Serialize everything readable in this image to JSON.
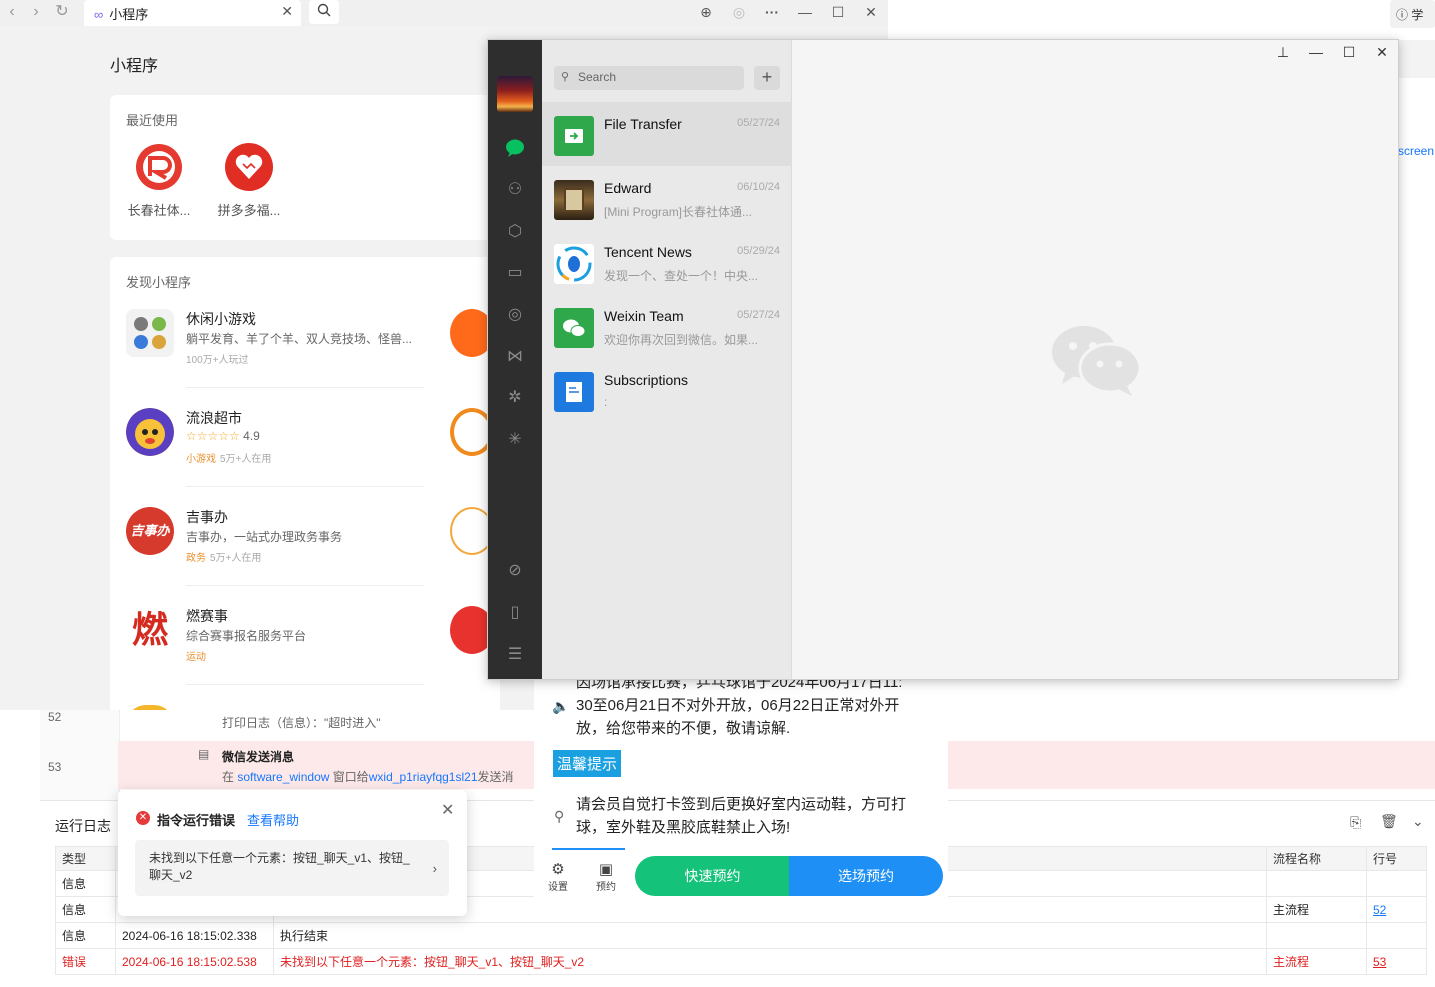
{
  "browser": {
    "tab_title": "小程序",
    "help_label": "学"
  },
  "screen_link": "screen",
  "miniprogram": {
    "page_title": "小程序",
    "recent": {
      "title": "最近使用",
      "apps": [
        {
          "label": "长春社体...",
          "color": "#e53a2f"
        },
        {
          "label": "拼多多福...",
          "color": "#e02e24"
        }
      ]
    },
    "discover": {
      "title": "发现小程序",
      "items": [
        {
          "name": "休闲小游戏",
          "desc": "躺平发育、羊了个羊、双人竞技场、怪兽...",
          "meta": "100万+人玩过",
          "tag": ""
        },
        {
          "name": "流浪超市",
          "rating": "4.9",
          "meta": "5万+人在用",
          "tag": "小游戏"
        },
        {
          "name": "吉事办",
          "desc": "吉事办，一站式办理政务事务",
          "meta": "5万+人在用",
          "tag": "政务",
          "icon_text": "吉事办"
        },
        {
          "name": "燃赛事",
          "desc": "综合赛事报名服务平台",
          "meta": "",
          "tag": "运动",
          "icon_text": "燃"
        }
      ]
    }
  },
  "wechat": {
    "search_placeholder": "Search",
    "chats": [
      {
        "name": "File Transfer",
        "time": "05/27/24",
        "preview": ""
      },
      {
        "name": "Edward",
        "time": "06/10/24",
        "preview": "[Mini Program]长春社体通..."
      },
      {
        "name": "Tencent News",
        "time": "05/29/24",
        "preview": "发现一个、查处一个！中央..."
      },
      {
        "name": "Weixin Team",
        "time": "05/27/24",
        "preview": "欢迎你再次回到微信。如果..."
      },
      {
        "name": "Subscriptions",
        "time": "",
        "preview": ":"
      }
    ]
  },
  "log": {
    "rows": [
      {
        "num": "52",
        "text": "打印日志（信息）：\"超时进入\""
      },
      {
        "num": "53",
        "title": "微信发送消息",
        "text_prefix": "在",
        "window": "software_window",
        "text_mid": "窗口给",
        "wxid": "wxid_p1riayfqg1sl21",
        "text_suffix": "发送消"
      }
    ],
    "panel_title": "运行日志",
    "headers": {
      "type": "类型",
      "flow": "流程名称",
      "line": "行号"
    },
    "entries": [
      {
        "type": "信息",
        "time": "",
        "msg": "",
        "flow": "",
        "line": ""
      },
      {
        "type": "信息",
        "time": "",
        "msg": "",
        "flow": "主流程",
        "line": "52"
      },
      {
        "type": "信息",
        "time": "2024-06-16 18:15:02.338",
        "msg": "执行结束",
        "flow": "",
        "line": ""
      },
      {
        "type": "错误",
        "time": "2024-06-16 18:15:02.538",
        "msg": "未找到以下任意一个元素：按钮_聊天_v1、按钮_聊天_v2",
        "flow": "主流程",
        "line": "53"
      }
    ]
  },
  "error_popup": {
    "title": "指令运行错误",
    "help_link": "查看帮助",
    "message": "未找到以下任意一个元素：按钮_聊天_v1、按钮_聊天_v2"
  },
  "notice": {
    "line0": "因场馆承接比赛，乒乓球馆于2024年06月17日11:",
    "line1": "30至06月21日不对外开放，06月22日正常对外开",
    "line2": "放，给您带来的不便，敬请谅解.",
    "tip_label": "温馨提示",
    "tip_line1": "请会员自觉打卡签到后更换好室内运动鞋，方可打",
    "tip_line2": "球，室外鞋及黑胶底鞋禁止入场!",
    "tab_settings": "设置",
    "tab_booking": "预约",
    "btn_quick": "快速预约",
    "btn_court": "选场预约"
  }
}
